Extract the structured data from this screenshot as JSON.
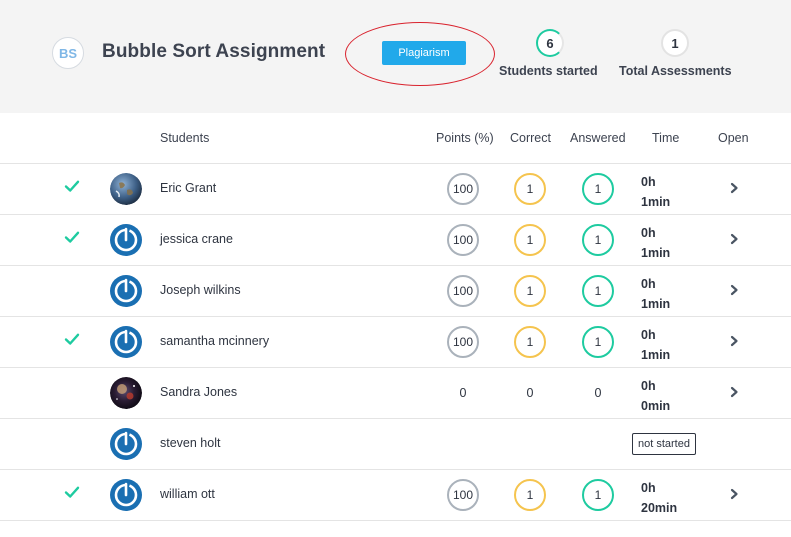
{
  "header": {
    "initials": "BS",
    "title": "Bubble Sort Assignment",
    "plagiarism_label": "Plagiarism",
    "students_started_count": "6",
    "students_started_label": "Students started",
    "total_assessments_count": "1",
    "total_assessments_label": "Total Assessments"
  },
  "columns": {
    "students": "Students",
    "points": "Points (%)",
    "correct": "Correct",
    "answered": "Answered",
    "time": "Time",
    "open": "Open"
  },
  "colors": {
    "accent": "#21a9ea",
    "check": "#1ecba0",
    "correct_ring": "#f5c44e",
    "answered_ring": "#1ecba0",
    "points_ring": "#aab2bb",
    "highlight": "#d9232e"
  },
  "rows": [
    {
      "name": "Eric Grant",
      "checked": true,
      "avatar": "earth-avatar",
      "points": "100",
      "correct": "1",
      "answered": "1",
      "hours": "0h",
      "minutes": "1min",
      "status": ""
    },
    {
      "name": "jessica crane",
      "checked": true,
      "avatar": "power-icon",
      "points": "100",
      "correct": "1",
      "answered": "1",
      "hours": "0h",
      "minutes": "1min",
      "status": ""
    },
    {
      "name": "Joseph wilkins",
      "checked": false,
      "avatar": "power-icon",
      "points": "100",
      "correct": "1",
      "answered": "1",
      "hours": "0h",
      "minutes": "1min",
      "status": ""
    },
    {
      "name": "samantha mcinnery",
      "checked": true,
      "avatar": "power-icon",
      "points": "100",
      "correct": "1",
      "answered": "1",
      "hours": "0h",
      "minutes": "1min",
      "status": ""
    },
    {
      "name": "Sandra Jones",
      "checked": false,
      "avatar": "space-avatar",
      "points": "0",
      "correct": "0",
      "answered": "0",
      "hours": "0h",
      "minutes": "0min",
      "status": ""
    },
    {
      "name": "steven holt",
      "checked": false,
      "avatar": "power-icon",
      "points": "",
      "correct": "",
      "answered": "",
      "hours": "",
      "minutes": "",
      "status": "not started"
    },
    {
      "name": "william ott",
      "checked": true,
      "avatar": "power-icon",
      "points": "100",
      "correct": "1",
      "answered": "1",
      "hours": "0h",
      "minutes": "20min",
      "status": ""
    }
  ]
}
